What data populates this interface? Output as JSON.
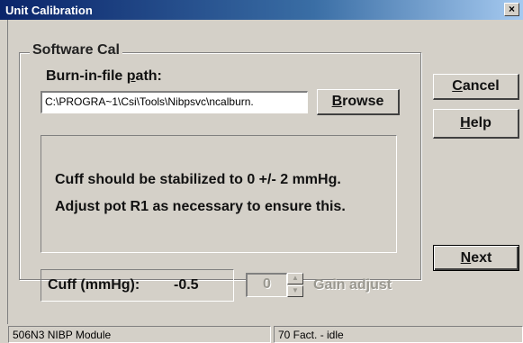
{
  "window": {
    "title": "Unit Calibration",
    "close_label": "×"
  },
  "group": {
    "title": "Software Cal",
    "path_label_pre": "Burn-in-file ",
    "path_label_mnemonic": "p",
    "path_label_post": "ath:",
    "path_value": "C:\\PROGRA~1\\Csi\\Tools\\Nibpsvc\\ncalburn."
  },
  "buttons": {
    "browse_mnemonic": "B",
    "browse_rest": "rowse",
    "cancel_mnemonic": "C",
    "cancel_rest": "ancel",
    "help_mnemonic": "H",
    "help_rest": "elp",
    "next_mnemonic": "N",
    "next_rest": "ext"
  },
  "message": {
    "line1": "Cuff should be stabilized to 0 +/- 2 mmHg.",
    "line2": "Adjust pot R1 as necessary to ensure this."
  },
  "cuff": {
    "label": "Cuff (mmHg):",
    "value": "-0.5"
  },
  "gain": {
    "value": "0",
    "label": "Gain adjust",
    "enabled": false
  },
  "status": {
    "module": "506N3 NIBP Module",
    "state": "70 Fact. - idle"
  },
  "colors": {
    "titlebar_start": "#0a246a",
    "titlebar_end": "#a6caf0",
    "face": "#d4d0c8",
    "disabled_text": "#9a9890"
  },
  "icons": {
    "close": "close-icon",
    "spin_up": "arrow-up-icon",
    "spin_down": "arrow-down-icon"
  }
}
